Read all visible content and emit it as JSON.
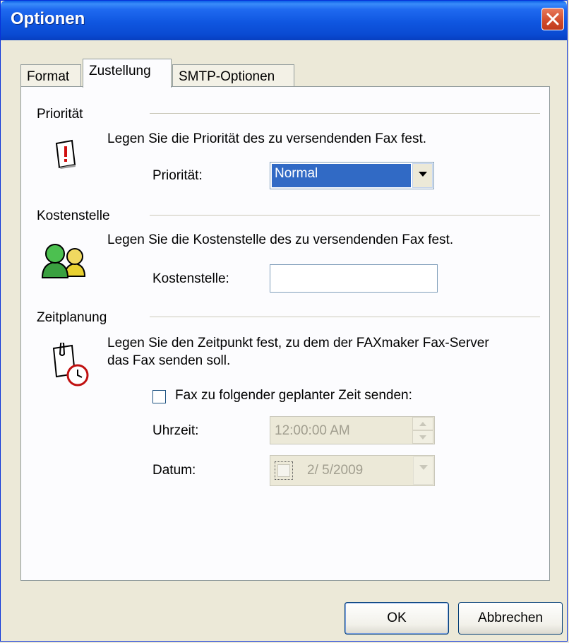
{
  "window": {
    "title": "Optionen"
  },
  "tabs": [
    {
      "label": "Format"
    },
    {
      "label": "Zustellung"
    },
    {
      "label": "SMTP-Optionen"
    }
  ],
  "priority": {
    "group_title": "Priorität",
    "description": "Legen Sie die Priorität des zu versendenden Fax fest.",
    "field_label": "Priorität:",
    "selected_value": "Normal"
  },
  "cost_center": {
    "group_title": "Kostenstelle",
    "description": "Legen Sie die Kostenstelle des zu versendenden Fax fest.",
    "field_label": "Kostenstelle:",
    "value": ""
  },
  "scheduling": {
    "group_title": "Zeitplanung",
    "description_line1": "Legen Sie den Zeitpunkt fest, zu dem der FAXmaker Fax-Server",
    "description_line2": "das Fax senden soll.",
    "checkbox_label": "Fax zu folgender geplanter Zeit senden:",
    "checkbox_checked": false,
    "time_label": "Uhrzeit:",
    "time_value": "12:00:00 AM",
    "date_label": "Datum:",
    "date_value": "2/ 5/2009"
  },
  "buttons": {
    "ok": "OK",
    "cancel": "Abbrechen"
  },
  "colors": {
    "title_bar": "#0a4ad2",
    "selection": "#316ac5",
    "dialog_bg": "#ece9d8",
    "close_button": "#d04a2a"
  }
}
